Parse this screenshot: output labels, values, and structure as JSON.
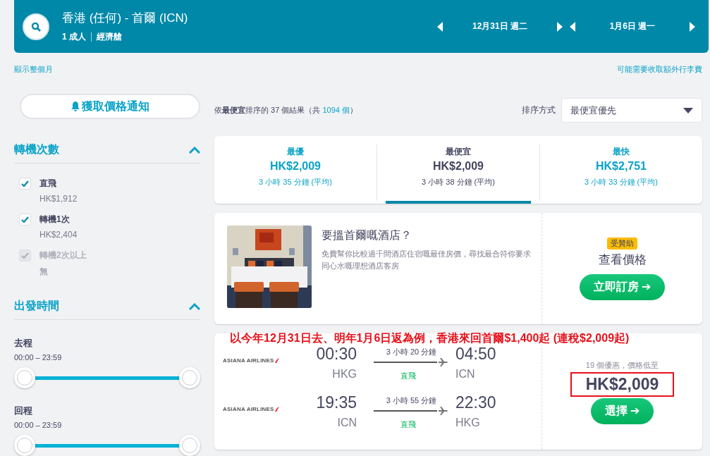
{
  "header": {
    "route": "香港 (任何) - 首爾 (ICN)",
    "passengers": "1 成人",
    "cabin": "經濟艙",
    "dates": [
      {
        "label": "12月31日 週二"
      },
      {
        "label": "1月6日 週一"
      }
    ]
  },
  "links": {
    "month": "顯示整個月",
    "baggage": "可能需要收取額外行李費"
  },
  "alert_button": "獲取價格通知",
  "filters": [
    {
      "kind": "checkbox",
      "title": "轉機次數",
      "expanded": true,
      "options": [
        {
          "label": "直飛",
          "price": "HK$1,912",
          "checked": true,
          "disabled": false
        },
        {
          "label": "轉機1次",
          "price": "HK$2,404",
          "checked": true,
          "disabled": false
        },
        {
          "label": "轉機2次以上",
          "price": "無",
          "checked": true,
          "disabled": true
        }
      ]
    },
    {
      "kind": "time",
      "title": "出發時間",
      "expanded": true,
      "ranges": [
        {
          "label": "去程",
          "range": "00:00 – 23:59",
          "level": 1
        },
        {
          "label": "回程",
          "range": "00:00 – 23:59",
          "level": 1
        }
      ]
    }
  ],
  "summary": {
    "text": "依**最便宜**排序的 37 個結果（共",
    "total": "1094 個",
    "tail": "）"
  },
  "sort": {
    "label": "排序方式",
    "value": "最便宜優先"
  },
  "sort_tabs": [
    {
      "title": "最優",
      "price": "HK$2,009",
      "duration": "3 小時 35 分鐘 (平均)",
      "selected": false
    },
    {
      "title": "最便宜",
      "price": "HK$2,009",
      "duration": "3 小時 38 分鐘 (平均)",
      "selected": true
    },
    {
      "title": "最快",
      "price": "HK$2,751",
      "duration": "3 小時 33 分鐘 (平均)",
      "selected": false
    }
  ],
  "hotel_ad": {
    "title": "要搵首爾嘅酒店？",
    "description": "免費幫你比較過千間酒店住宿嘅最佳房價，尋找最合符你要求同心水嘅理想酒店客房",
    "badge": "受贊助",
    "cta_label": "查看價格",
    "button": "立即訂房 ➔"
  },
  "annotation": "以今年12月31日去、明年1月6日返為例，香港來回首爾$1,400起 (連稅$2,009起)",
  "flight": {
    "legs": [
      {
        "airline": "ASIANA AIRLINES",
        "depart_time": "00:30",
        "depart_airport": "HKG",
        "duration": "3 小時 20 分鐘",
        "stops": "直飛",
        "arrive_time": "04:50",
        "arrive_airport": "ICN"
      },
      {
        "airline": "ASIANA AIRLINES",
        "depart_time": "19:35",
        "depart_airport": "ICN",
        "duration": "3 小時 55 分鐘",
        "stops": "直飛",
        "arrive_time": "22:30",
        "arrive_airport": "HKG"
      }
    ],
    "deals": "19 個優惠，價格低至",
    "price": "HK$2,009",
    "highlighted": true,
    "button": "選擇 ➔"
  }
}
